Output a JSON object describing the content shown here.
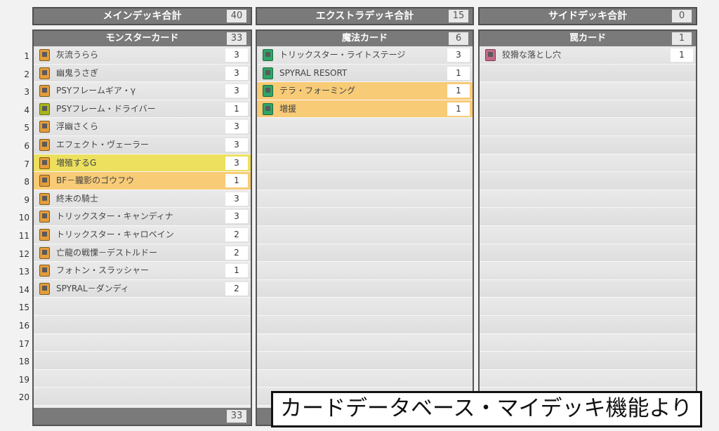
{
  "main": {
    "title": "メインデッキ合計",
    "total": "40",
    "section": {
      "title": "モンスターカード",
      "count": "33",
      "footer_count": "33"
    },
    "rows": [
      {
        "name": "灰流うらら",
        "qty": "3",
        "icon": "orange"
      },
      {
        "name": "幽鬼うさぎ",
        "qty": "3",
        "icon": "orange"
      },
      {
        "name": "PSYフレームギア・γ",
        "qty": "3",
        "icon": "orange"
      },
      {
        "name": "PSYフレーム・ドライバー",
        "qty": "1",
        "icon": "yellowgreen"
      },
      {
        "name": "浮幽さくら",
        "qty": "3",
        "icon": "orange"
      },
      {
        "name": "エフェクト・ヴェーラー",
        "qty": "3",
        "icon": "orange"
      },
      {
        "name": "増殖するG",
        "qty": "3",
        "icon": "orange",
        "hl": "yellow"
      },
      {
        "name": "BF－朧影のゴウフウ",
        "qty": "1",
        "icon": "orange",
        "hl": "orange"
      },
      {
        "name": "終末の騎士",
        "qty": "3",
        "icon": "orange"
      },
      {
        "name": "トリックスター・キャンディナ",
        "qty": "3",
        "icon": "orange"
      },
      {
        "name": "トリックスター・キャロベイン",
        "qty": "2",
        "icon": "orange"
      },
      {
        "name": "亡龍の戦慄－デストルドー",
        "qty": "2",
        "icon": "orange"
      },
      {
        "name": "フォトン・スラッシャー",
        "qty": "1",
        "icon": "orange"
      },
      {
        "name": "SPYRAL－ダンディ",
        "qty": "2",
        "icon": "orange"
      }
    ]
  },
  "extra": {
    "title": "エクストラデッキ合計",
    "total": "15",
    "section": {
      "title": "魔法カード",
      "count": "6"
    },
    "rows": [
      {
        "name": "トリックスター・ライトステージ",
        "qty": "3",
        "icon": "green"
      },
      {
        "name": "SPYRAL RESORT",
        "qty": "1",
        "icon": "green"
      },
      {
        "name": "テラ・フォーミング",
        "qty": "1",
        "icon": "green",
        "hl": "orange"
      },
      {
        "name": "増援",
        "qty": "1",
        "icon": "green",
        "hl": "orange"
      }
    ]
  },
  "side": {
    "title": "サイドデッキ合計",
    "total": "0",
    "section": {
      "title": "罠カード",
      "count": "1"
    },
    "rows": [
      {
        "name": "狡猾な落とし穴",
        "qty": "1",
        "icon": "pink"
      }
    ]
  },
  "row_numbers": [
    "1",
    "2",
    "3",
    "4",
    "5",
    "6",
    "7",
    "8",
    "9",
    "10",
    "11",
    "12",
    "13",
    "14",
    "15",
    "16",
    "17",
    "18",
    "19",
    "20"
  ],
  "overlay_text": "カードデータベース・マイデッキ機能より",
  "colors": {
    "header_bg": "#7a7a7a",
    "highlight_yellow": "#ece05e",
    "highlight_orange": "#f8cb77",
    "monster_icon": "#e59c3a",
    "spell_icon": "#2fa567",
    "trap_icon": "#c56a86"
  }
}
